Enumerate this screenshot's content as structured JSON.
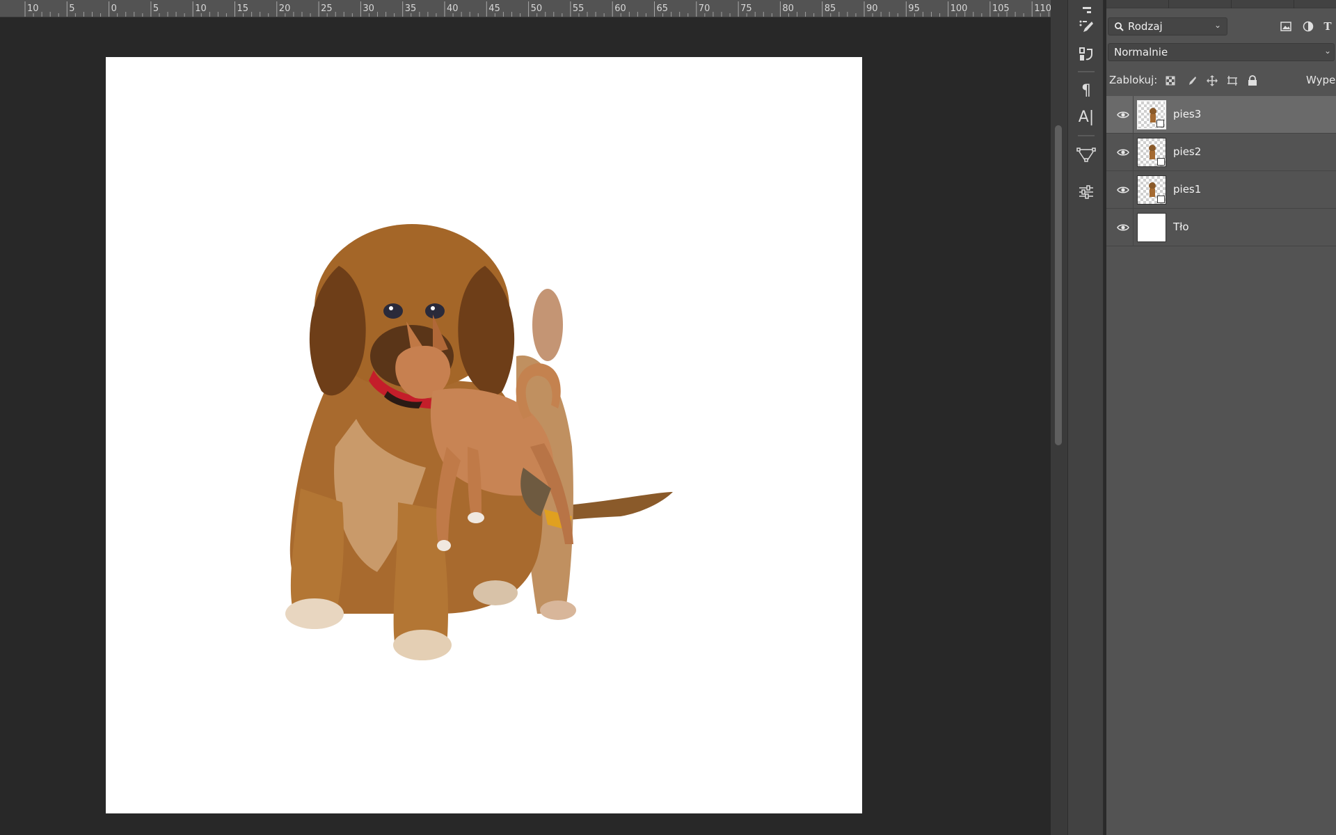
{
  "ruler": {
    "labels": [
      "10",
      "5",
      "0",
      "5",
      "10",
      "15",
      "20",
      "25",
      "30",
      "35",
      "40",
      "45",
      "50",
      "55",
      "60",
      "65",
      "70",
      "75",
      "80",
      "85",
      "90",
      "95",
      "100",
      "105",
      "110"
    ]
  },
  "layers_panel": {
    "kind_filter": "Rodzaj",
    "blend_mode": "Normalnie",
    "lock_label": "Zablokuj:",
    "fill_label": "Wype",
    "layers": [
      {
        "name": "pies3",
        "selected": true,
        "visible": true
      },
      {
        "name": "pies2",
        "selected": false,
        "visible": true
      },
      {
        "name": "pies1",
        "selected": false,
        "visible": true
      },
      {
        "name": "Tło",
        "selected": false,
        "visible": true
      }
    ]
  },
  "colors": {
    "workspace": "#282828",
    "panel": "#535353",
    "selected_layer": "#6a6a6a",
    "document": "#ffffff"
  },
  "icons": {
    "tools": [
      "brush-settings-icon",
      "clone-source-icon",
      "paragraph-icon",
      "character-icon",
      "paths-icon",
      "adjustments-icon"
    ],
    "filters": [
      "image-filter-icon",
      "adjustment-filter-icon",
      "type-filter-icon"
    ],
    "locks": [
      "lock-transparent-icon",
      "lock-pixels-icon",
      "lock-position-icon",
      "lock-artboard-icon",
      "lock-all-icon"
    ]
  }
}
